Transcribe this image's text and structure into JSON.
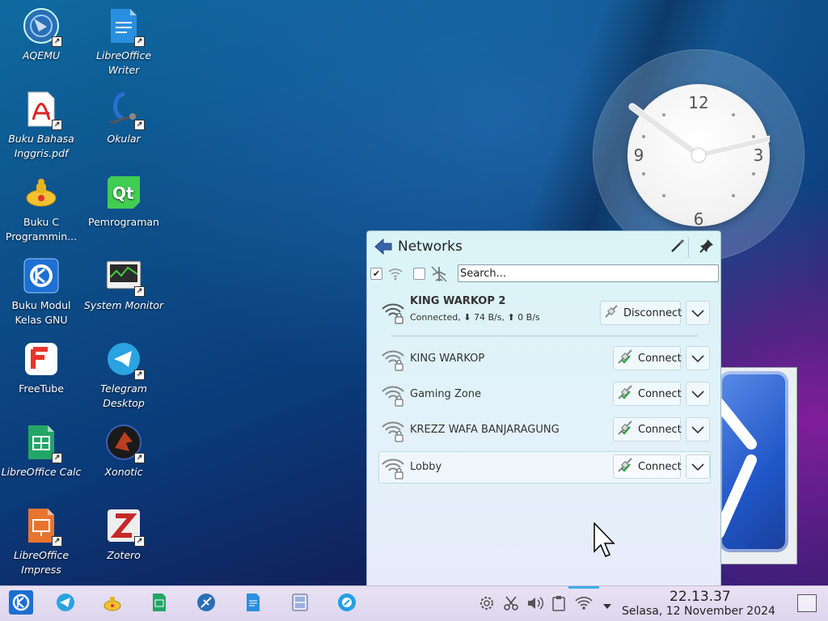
{
  "desktop": {
    "icons": [
      {
        "label": "AQEMU",
        "italic": true
      },
      {
        "label": "LibreOffice Writer",
        "italic": true
      },
      {
        "label": "Buku Bahasa Inggris.pdf",
        "italic": true
      },
      {
        "label": "Okular",
        "italic": true
      },
      {
        "label": "Buku C Programmin...",
        "italic": false
      },
      {
        "label": "Pemrograman",
        "italic": false
      },
      {
        "label": "Buku Modul Kelas GNU",
        "italic": false
      },
      {
        "label": "System Monitor",
        "italic": true
      },
      {
        "label": "FreeTube",
        "italic": false
      },
      {
        "label": "Telegram Desktop",
        "italic": true
      },
      {
        "label": "LibreOffice Calc",
        "italic": true
      },
      {
        "label": "Xonotic",
        "italic": true
      },
      {
        "label": "LibreOffice Impress",
        "italic": true
      },
      {
        "label": "Zotero",
        "italic": true
      }
    ]
  },
  "clock": {
    "numerals": [
      "12",
      "3",
      "6",
      "9"
    ]
  },
  "networks": {
    "title": "Networks",
    "search_placeholder": "Search...",
    "connected": {
      "ssid": "KING WARKOP 2",
      "status": "Connected,",
      "down": "74 B/s,",
      "up": "0 B/s",
      "action": "Disconnect"
    },
    "available": [
      {
        "ssid": "KING WARKOP",
        "action": "Connect"
      },
      {
        "ssid": "Gaming Zone",
        "action": "Connect"
      },
      {
        "ssid": "KREZZ WAFA BANJARAGUNG",
        "action": "Connect"
      },
      {
        "ssid": "Lobby",
        "action": "Connect"
      }
    ]
  },
  "taskbar": {
    "time": "22.13.37",
    "date": "Selasa, 12 November 2024"
  },
  "colors": {
    "accent": "#3daee9",
    "kde_blue": "#1d6fd1"
  }
}
